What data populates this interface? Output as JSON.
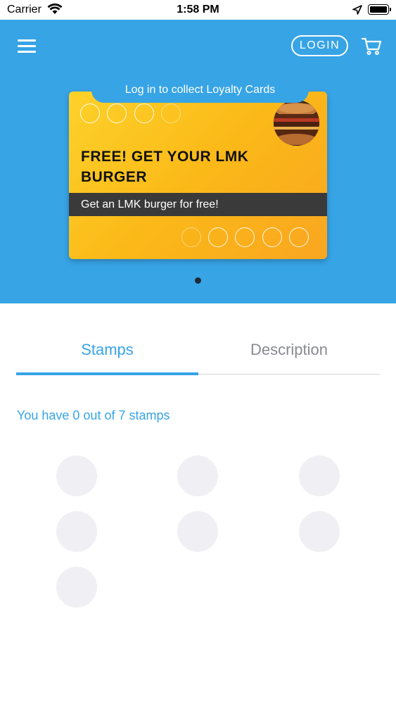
{
  "status_bar": {
    "carrier": "Carrier",
    "time": "1:58 PM"
  },
  "header": {
    "login_label": "LOGIN",
    "menu_icon": "hamburger-menu-icon",
    "cart_icon": "cart-icon"
  },
  "card": {
    "banner": "Log in to collect Loyalty Cards",
    "title": "FREE! GET YOUR LMK BURGER",
    "subtitle": "Get an LMK burger for free!",
    "image": "burger-photo",
    "gradient_colors": [
      "#fdd22a",
      "#f9a620"
    ]
  },
  "carousel": {
    "page_count": 1,
    "current_page": 1
  },
  "tabs": [
    {
      "label": "Stamps",
      "active": true
    },
    {
      "label": "Description",
      "active": false
    }
  ],
  "stamps": {
    "summary": "You have 0 out of 7 stamps",
    "collected": 0,
    "total": 7
  },
  "colors": {
    "accent": "#37a4e6",
    "stamp_empty": "#f0eff3",
    "tab_inactive": "#888a8f"
  }
}
